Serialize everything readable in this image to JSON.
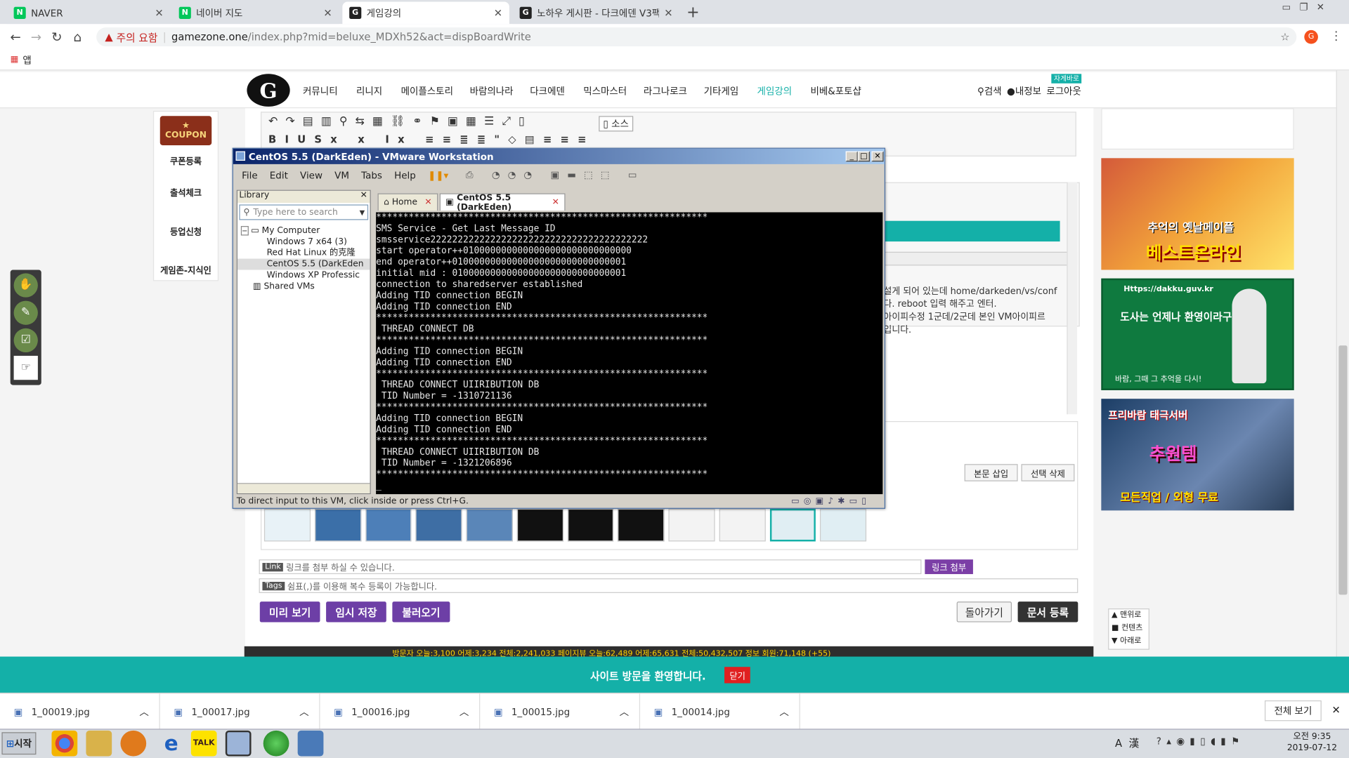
{
  "browser": {
    "tabs": [
      {
        "label": "NAVER",
        "fav": "N",
        "fav_color": "#03c75a"
      },
      {
        "label": "네이버 지도",
        "fav": "N",
        "fav_color": "#03c75a"
      },
      {
        "label": "게임강의",
        "fav": "G",
        "fav_color": "#222222",
        "active": true
      },
      {
        "label": "노하우 게시판 - 다크에덴 V3팩",
        "fav": "G",
        "fav_color": "#222222"
      }
    ],
    "new_tab": "+",
    "security_label": "주의 요함",
    "url_host": "gamezone.one",
    "url_path": "/index.php?mid=beluxe_MDXh52&act=dispBoardWrite",
    "bookmarks_label": "앱",
    "profile_initial": "G"
  },
  "site": {
    "logo_text": "G",
    "nav": [
      "커뮤니티",
      "리니지",
      "메이플스토리",
      "바람의나라",
      "다크에덴",
      "믹스마스터",
      "라그나로크",
      "기타게임",
      "게임강의",
      "비베&포토샵"
    ],
    "nav_active_index": 8,
    "badge": "자게바로",
    "util": [
      "검색",
      "내정보",
      "로그아웃"
    ],
    "left_sidebar": {
      "coupon": "COUPON",
      "items": [
        "쿠폰등록",
        "출석체크",
        "등업신청",
        "게임존-지식인"
      ]
    }
  },
  "editor": {
    "source_label": "소스",
    "side_text_lines": [
      "설게 되어 있는데 home/darkeden/vs/conf",
      "다. reboot 입력 해주고 엔터.",
      "아이피수정 1군데/2군데 본인 VM아이피르",
      "입니다."
    ],
    "buttons_right": [
      "본문 삽입",
      "선택 삭제"
    ],
    "link_tag": "Link",
    "link_placeholder": "링크를 첨부 하실 수 있습니다.",
    "link_button": "링크 첨부",
    "tags_tag": "Tags",
    "tags_placeholder": "쉼표(,)를 이용해 복수 등록이 가능합니다.",
    "bottom_left_buttons": [
      "미리 보기",
      "임시 저장",
      "불러오기"
    ],
    "bottom_right_buttons": [
      "돌아가기",
      "문서 등록"
    ]
  },
  "right_ads": [
    {
      "line1": "추억의 옛날메이플",
      "line2": "베스트온라인"
    },
    {
      "url": "Https://dakku.guv.kr",
      "line1": "도사는 언제나 환영이라구!",
      "line2": "바람, 그때 그 추억을 다시!"
    },
    {
      "line1": "프리바람 태극서버",
      "line2": "추원템",
      "line3": "모든직업 / 외형 무료"
    }
  ],
  "floating_nav": [
    "▲ 맨위로",
    "■ 컨텐츠",
    "▼ 아래로"
  ],
  "footer": {
    "stats": "방문자 오늘:3,100 어제:3,234 전체:2,241,033   페이지뷰 오늘:62,489 어제:65,631 전체:50,432,507   정보 회원:71,148 (+55)"
  },
  "teal_bar": {
    "message": "사이트 방문을 환영합니다.",
    "close_label": "닫기"
  },
  "downloads": {
    "files": [
      "1_00019.jpg",
      "1_00017.jpg",
      "1_00016.jpg",
      "1_00015.jpg",
      "1_00014.jpg"
    ],
    "show_all": "전체 보기",
    "close": "✕"
  },
  "taskbar": {
    "start_label": "시작",
    "ime": "A 漢",
    "clock_time": "오전 9:35",
    "clock_date": "2019-07-12"
  },
  "vmware": {
    "title": "CentOS 5.5 (DarkEden) - VMware Workstation",
    "menu": [
      "File",
      "Edit",
      "View",
      "VM",
      "Tabs",
      "Help"
    ],
    "library_title": "Library",
    "library_search_placeholder": "Type here to search",
    "tree": [
      {
        "label": "My Computer",
        "level": 0
      },
      {
        "label": "Windows 7 x64 (3)",
        "level": 1
      },
      {
        "label": "Red Hat Linux 的克隆",
        "level": 1
      },
      {
        "label": "CentOS 5.5 (DarkEden",
        "level": 1,
        "selected": true
      },
      {
        "label": "Windows XP Professic",
        "level": 1
      },
      {
        "label": "Shared VMs",
        "level": 0
      }
    ],
    "tabs": [
      {
        "label": "Home"
      },
      {
        "label": "CentOS 5.5 (DarkEden)",
        "active": true
      }
    ],
    "terminal_lines": [
      "*************************************************************",
      "SMS Service - Get Last Message ID",
      "smsservice2222222222222222222222222222222222222222",
      "start operator++0100000000000000000000000000000",
      "end operator++01000000000000000000000000000001",
      "initial mid : 01000000000000000000000000000001",
      "connection to sharedserver established",
      "Adding TID connection BEGIN",
      "Adding TID connection END",
      "*************************************************************",
      " THREAD CONNECT DB",
      "*************************************************************",
      "Adding TID connection BEGIN",
      "Adding TID connection END",
      "*************************************************************",
      " THREAD CONNECT UIIRIBUTION DB",
      " TID Number = -1310721136",
      "*************************************************************",
      "Adding TID connection BEGIN",
      "Adding TID connection END",
      "*************************************************************",
      " THREAD CONNECT UIIRIBUTION DB",
      " TID Number = -1321206896",
      "*************************************************************",
      "_"
    ],
    "status": "To direct input to this VM, click inside or press Ctrl+G."
  }
}
